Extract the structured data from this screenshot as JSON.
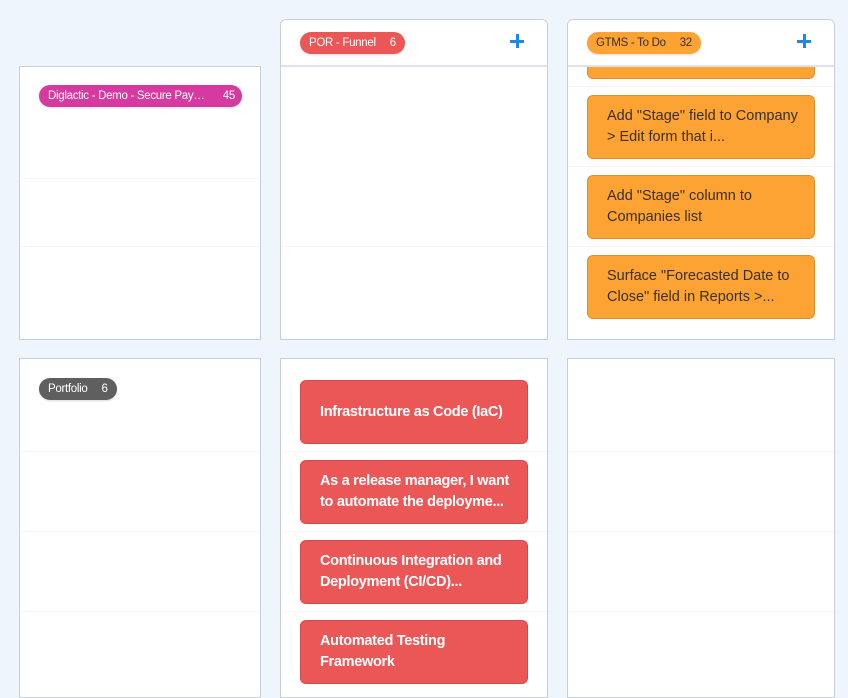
{
  "board": {
    "columns": [
      {
        "id": "por-funnel",
        "label": "POR - Funnel",
        "count": "6",
        "color": "#eb5757",
        "add_label": "+"
      },
      {
        "id": "gtms-todo",
        "label": "GTMS - To Do",
        "count": "32",
        "color": "#fda333",
        "add_label": "+"
      }
    ],
    "swimlanes": [
      {
        "label": "Diglactic - Demo - Secure Payme...",
        "count": "45",
        "color": "#d63aa0",
        "cells": {
          "por-funnel": [],
          "gtms-todo": [
            "Add \"Stage\" field to Company > Edit form that i...",
            "Add \"Stage\" column to Companies list",
            "Surface \"Forecasted Date to Close\" field in Reports >..."
          ]
        }
      },
      {
        "label": "Portfolio",
        "count": "6",
        "color": "#5f5f5f",
        "cells": {
          "por-funnel": [
            "Infrastructure as Code (IaC)",
            "As a release manager, I want to automate the deployme...",
            "Continuous Integration and Deployment (CI/CD)...",
            "Automated Testing Framework"
          ],
          "gtms-todo": []
        }
      }
    ]
  }
}
